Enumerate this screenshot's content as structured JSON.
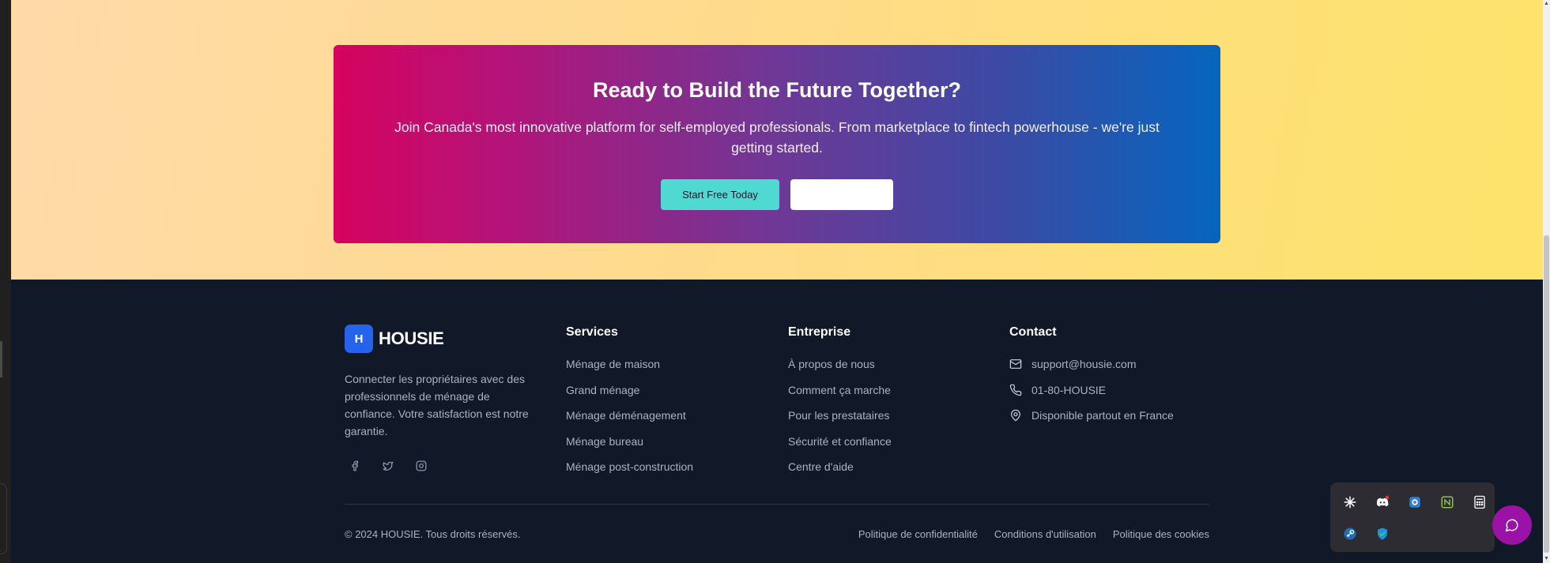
{
  "cta": {
    "title": "Ready to Build the Future Together?",
    "description": "Join Canada's most innovative platform for self-employed professionals. From marketplace to fintech powerhouse - we're just getting started.",
    "primary_button": "Start Free Today",
    "secondary_button": ""
  },
  "footer": {
    "brand": {
      "logo_letter": "H",
      "name": "HOUSIE"
    },
    "about": "Connecter les propriétaires avec des professionnels de ménage de confiance. Votre satisfaction est notre garantie.",
    "socials": [
      "facebook-icon",
      "twitter-icon",
      "instagram-icon"
    ],
    "services": {
      "title": "Services",
      "items": [
        "Ménage de maison",
        "Grand ménage",
        "Ménage déménagement",
        "Ménage bureau",
        "Ménage post-construction"
      ]
    },
    "entreprise": {
      "title": "Entreprise",
      "items": [
        "À propos de nous",
        "Comment ça marche",
        "Pour les prestataires",
        "Sécurité et confiance",
        "Centre d'aide"
      ]
    },
    "contact": {
      "title": "Contact",
      "items": [
        {
          "icon": "mail-icon",
          "text": "support@housie.com"
        },
        {
          "icon": "phone-icon",
          "text": "01-80-HOUSIE"
        },
        {
          "icon": "map-pin-icon",
          "text": "Disponible partout en France"
        }
      ]
    },
    "copyright": "© 2024 HOUSIE. Tous droits réservés.",
    "legal": [
      "Politique de confidentialité",
      "Conditions d'utilisation",
      "Politique des cookies"
    ]
  },
  "tray": {
    "icons": [
      "claude-icon",
      "discord-icon",
      "app-shield-icon",
      "git-icon",
      "calculator-icon",
      "steam-icon",
      "security-shield-icon"
    ]
  },
  "chat": {
    "icon": "chat-icon"
  },
  "colors": {
    "cta_start": "#d6035f",
    "cta_end": "#0565be",
    "primary_button": "#4fd9d2",
    "footer_bg": "#111827",
    "logo_bg": "#2563eb",
    "chat_bubble": "#9b12a6"
  }
}
